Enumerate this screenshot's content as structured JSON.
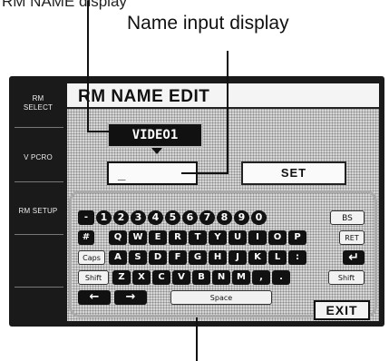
{
  "callouts": {
    "top_partial": "RM NAME display",
    "name_input": "Name input display"
  },
  "sidebar": {
    "rm_select": [
      "RM",
      "SELECT"
    ],
    "vpcro": "V PCRO",
    "rm_setup": "RM SETUP"
  },
  "screen": {
    "title": "RM NAME EDIT",
    "name_display": "VIDEO1",
    "input_value": "_",
    "set_label": "SET",
    "exit_label": "EXIT"
  },
  "keyboard": {
    "row1": [
      "-",
      "1",
      "2",
      "3",
      "4",
      "5",
      "6",
      "7",
      "8",
      "9",
      "0",
      "BS"
    ],
    "row2": [
      "#",
      "Q",
      "W",
      "E",
      "R",
      "T",
      "Y",
      "U",
      "I",
      "O",
      "P",
      "RET"
    ],
    "row3": [
      "Caps",
      "A",
      "S",
      "D",
      "F",
      "G",
      "H",
      "J",
      "K",
      "L",
      ":",
      "↵"
    ],
    "row4": [
      "Shift",
      "Z",
      "X",
      "C",
      "V",
      "B",
      "N",
      "M",
      ",",
      ".",
      "Shift"
    ],
    "row5": [
      "←",
      "→",
      "Space"
    ]
  }
}
